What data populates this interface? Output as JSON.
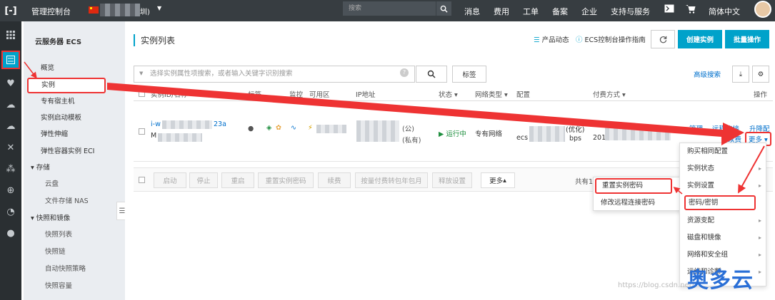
{
  "topbar": {
    "brand": "管理控制台",
    "region": "圳)",
    "search_placeholder": "搜索",
    "nav": [
      "消息",
      "费用",
      "工单",
      "备案",
      "企业",
      "支持与服务"
    ],
    "language": "简体中文"
  },
  "sidebar": {
    "title": "云服务器 ECS",
    "items": [
      {
        "label": "概览"
      },
      {
        "label": "实例"
      },
      {
        "label": "专有宿主机"
      },
      {
        "label": "实例启动模板"
      },
      {
        "label": "弹性伸缩"
      },
      {
        "label": "弹性容器实例 ECI"
      },
      {
        "label": "存储"
      },
      {
        "label": "云盘"
      },
      {
        "label": "文件存储 NAS"
      },
      {
        "label": "快照和镜像"
      },
      {
        "label": "快照列表"
      },
      {
        "label": "快照链"
      },
      {
        "label": "自动快照策略"
      },
      {
        "label": "快照容量"
      }
    ]
  },
  "main": {
    "title": "实例列表",
    "product_news": "产品动态",
    "ecs_guide": "ECS控制台操作指南",
    "create_button": "创建实例",
    "batch_button": "批量操作",
    "filter_placeholder": "选择实例属性项搜索，或者输入关键字识别搜索",
    "tag_button": "标签",
    "advanced_search": "高级搜索",
    "columns": [
      "实例ID/名称",
      "标签",
      "监控",
      "可用区",
      "IP地址",
      "状态",
      "网络类型",
      "配置",
      "付费方式",
      "操作"
    ],
    "row": {
      "id": "i-w",
      "id_suffix": "23a",
      "name_prefix": "M",
      "ip_suffix_1": "(公)",
      "ip_suffix_2": "(私有)",
      "status": "运行中",
      "network": "专有网络",
      "config_prefix": "ecs",
      "config_mid": "(优化)",
      "config_suffix": "bps",
      "payment": "201",
      "actions": [
        "管理",
        "远程连接",
        "升降配",
        "续费",
        "更多"
      ]
    },
    "bulk_buttons": [
      "启动",
      "停止",
      "重启",
      "重置实例密码",
      "续费",
      "按量付费转包年包月",
      "释放设置",
      "更多"
    ],
    "pagination": "共有1条，每页显示"
  },
  "more_menu": {
    "items": [
      "购买相同配置",
      "实例状态",
      "实例设置",
      "密码/密钥",
      "资源变配",
      "磁盘和镜像",
      "网络和安全组",
      "运维和诊断"
    ]
  },
  "password_submenu": {
    "items": [
      "重置实例密码",
      "修改远程连接密码"
    ]
  },
  "watermark": {
    "text": "奥多云",
    "url": "https://blog.csdn.net/"
  },
  "colors": {
    "accent": "#00a2ca",
    "annotation": "#e33333",
    "topbar": "#373d41"
  }
}
